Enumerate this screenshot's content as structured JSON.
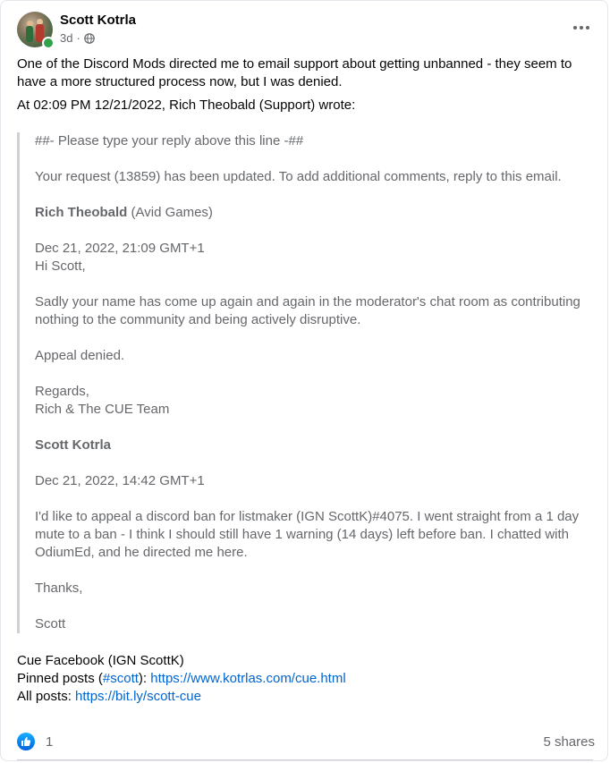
{
  "post": {
    "author": "Scott Kotrla",
    "time": "3d",
    "separator": "·",
    "intro": "One of the Discord Mods directed me to email support about getting unbanned - they seem to have a more structured process now, but I was denied.",
    "wrote_line": "At 02:09 PM 12/21/2022, Rich Theobald (Support) wrote:"
  },
  "quote": {
    "reply_marker": "##- Please type your reply above this line -##",
    "updated": "Your request (13859) has been updated. To add additional comments, reply to this email.",
    "sender1_name": "Rich Theobald",
    "sender1_org": " (Avid Games)",
    "date1": "Dec 21, 2022, 21:09 GMT+1",
    "greeting": "Hi Scott,",
    "sadly": "Sadly your name has come up again and again in the moderator's chat room as contributing nothing to the community and being actively disruptive.",
    "denied": "Appeal denied.",
    "regards": "Regards,",
    "signoff": "Rich & The CUE Team",
    "sender2_name": "Scott Kotrla",
    "date2": "Dec 21, 2022, 14:42 GMT+1",
    "appeal": "I'd like to appeal a discord ban for listmaker (IGN ScottK)#4075. I went straight from a 1 day mute to a ban - I think I should still have 1 warning (14 days) left before ban. I chatted with OdiumEd, and he directed me here.",
    "thanks": "Thanks,",
    "sig": "Scott"
  },
  "footer": {
    "line1": "Cue Facebook (IGN ScottK)",
    "pinned_prefix": "Pinned posts (",
    "pinned_tag": "#scott",
    "pinned_mid": "): ",
    "pinned_url": "https://www.kotrlas.com/cue.html",
    "all_prefix": "All posts: ",
    "all_url": "https://bit.ly/scott-cue"
  },
  "reactions": {
    "icon": "like-icon",
    "count": "1",
    "shares": "5 shares"
  }
}
